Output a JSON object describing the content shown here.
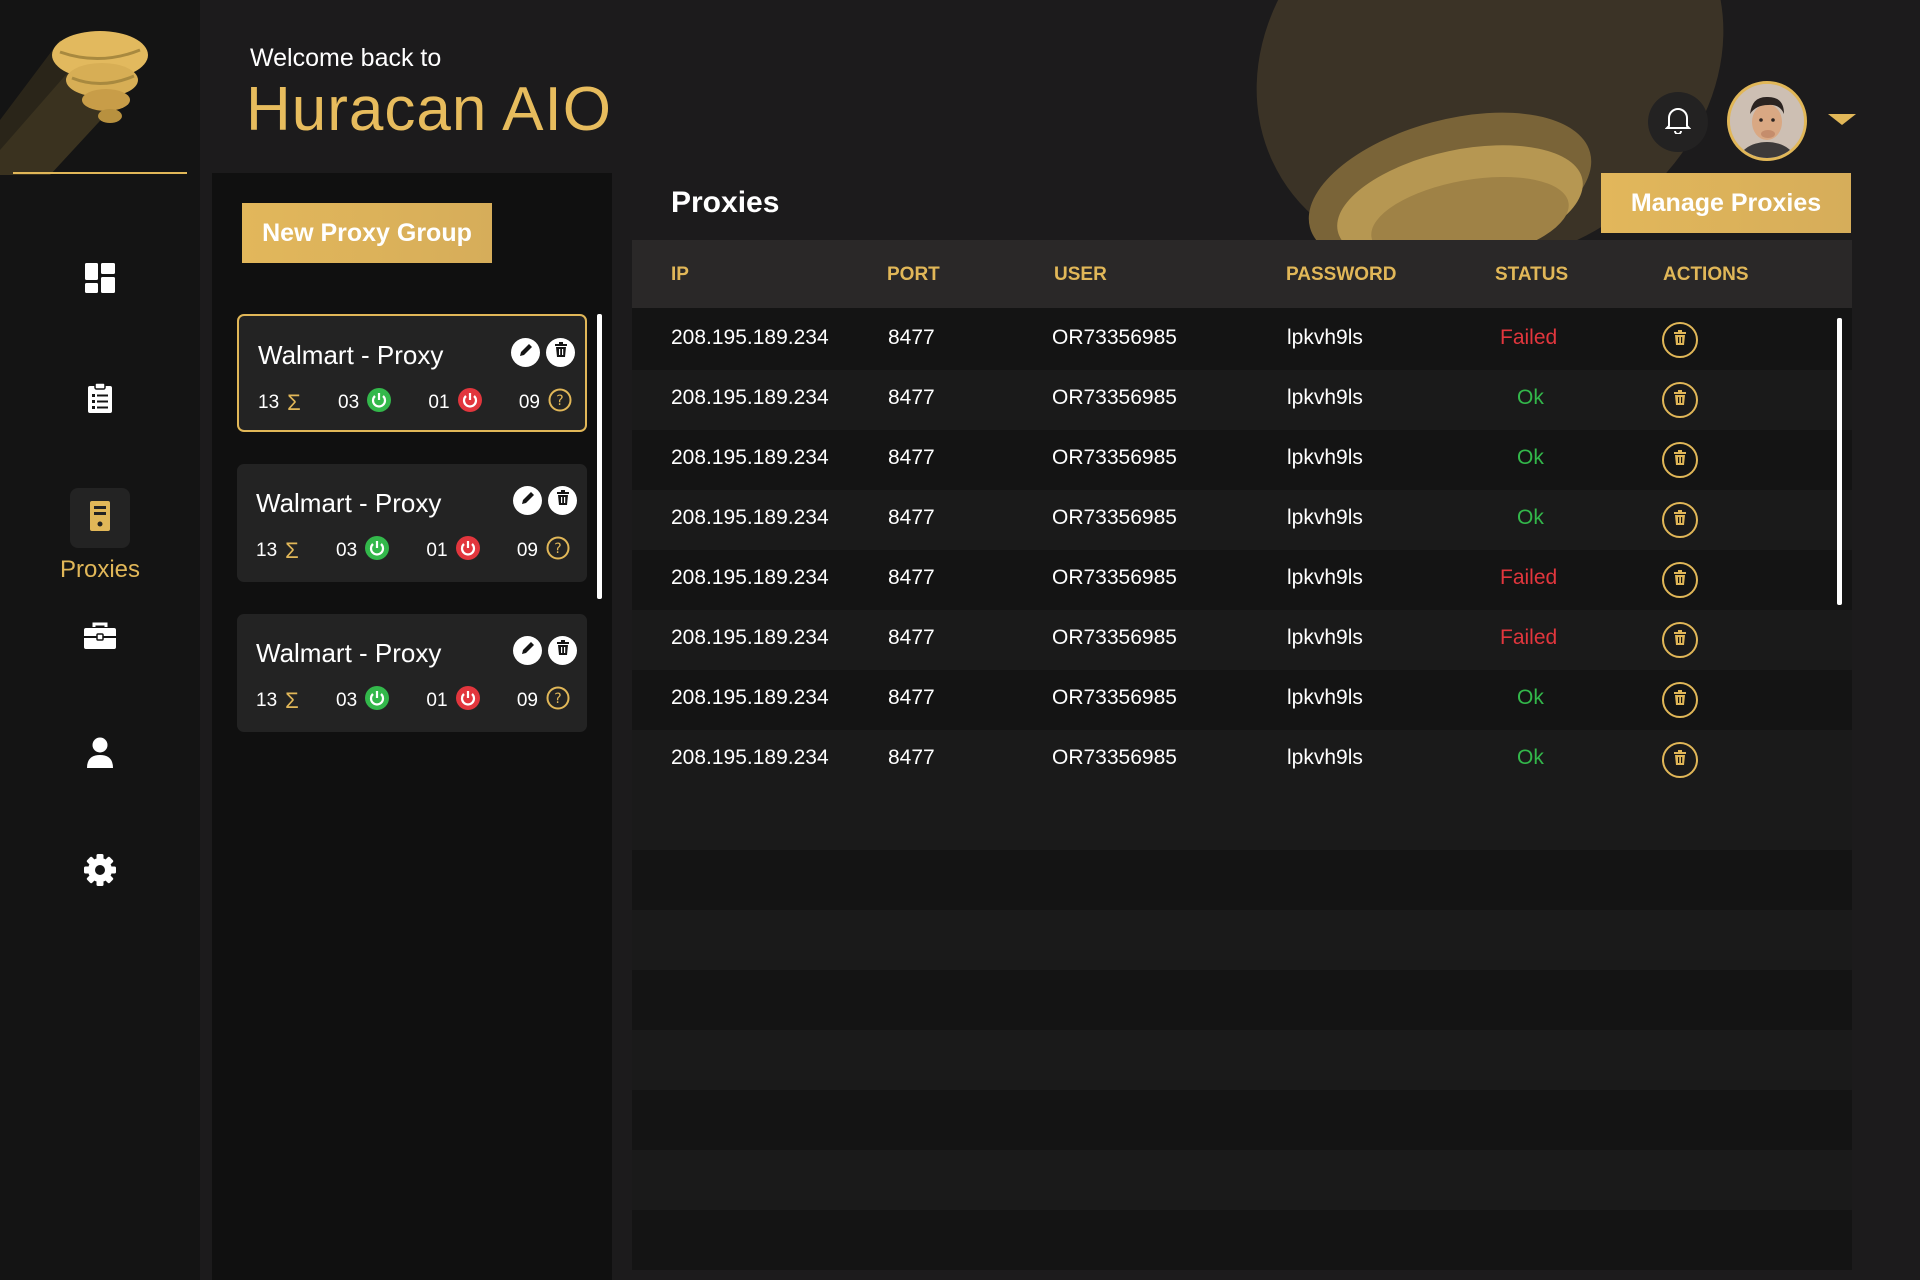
{
  "app": {
    "welcome": "Welcome back to",
    "brand": "Huracan AIO"
  },
  "sidebar": {
    "items": [
      {
        "name": "dashboard",
        "icon": "dashboard-icon",
        "label": ""
      },
      {
        "name": "tasks",
        "icon": "clipboard-icon",
        "label": ""
      },
      {
        "name": "proxies",
        "icon": "proxy-icon",
        "label": "Proxies",
        "active": true
      },
      {
        "name": "profiles",
        "icon": "briefcase-icon",
        "label": ""
      },
      {
        "name": "accounts",
        "icon": "user-icon",
        "label": ""
      },
      {
        "name": "settings",
        "icon": "gear-icon",
        "label": ""
      }
    ]
  },
  "groups": {
    "new_button": "New Proxy Group",
    "cards": [
      {
        "title": "Walmart - Proxy",
        "total": "13",
        "ok": "03",
        "failed": "01",
        "unknown": "09",
        "selected": true
      },
      {
        "title": "Walmart - Proxy",
        "total": "13",
        "ok": "03",
        "failed": "01",
        "unknown": "09",
        "selected": false
      },
      {
        "title": "Walmart - Proxy",
        "total": "13",
        "ok": "03",
        "failed": "01",
        "unknown": "09",
        "selected": false
      }
    ]
  },
  "proxies": {
    "title": "Proxies",
    "manage_button": "Manage Proxies",
    "columns": [
      "IP",
      "PORT",
      "USER",
      "PASSWORD",
      "STATUS",
      "ACTIONS"
    ],
    "rows": [
      {
        "ip": "208.195.189.234",
        "port": "8477",
        "user": "OR73356985",
        "password": "lpkvh9ls",
        "status": "Failed"
      },
      {
        "ip": "208.195.189.234",
        "port": "8477",
        "user": "OR73356985",
        "password": "lpkvh9ls",
        "status": "Ok"
      },
      {
        "ip": "208.195.189.234",
        "port": "8477",
        "user": "OR73356985",
        "password": "lpkvh9ls",
        "status": "Ok"
      },
      {
        "ip": "208.195.189.234",
        "port": "8477",
        "user": "OR73356985",
        "password": "lpkvh9ls",
        "status": "Ok"
      },
      {
        "ip": "208.195.189.234",
        "port": "8477",
        "user": "OR73356985",
        "password": "lpkvh9ls",
        "status": "Failed"
      },
      {
        "ip": "208.195.189.234",
        "port": "8477",
        "user": "OR73356985",
        "password": "lpkvh9ls",
        "status": "Failed"
      },
      {
        "ip": "208.195.189.234",
        "port": "8477",
        "user": "OR73356985",
        "password": "lpkvh9ls",
        "status": "Ok"
      },
      {
        "ip": "208.195.189.234",
        "port": "8477",
        "user": "OR73356985",
        "password": "lpkvh9ls",
        "status": "Ok"
      }
    ]
  },
  "colors": {
    "accent": "#e1b758",
    "ok": "#33b84b",
    "failed": "#e2363d",
    "background": "#1c1b1c"
  }
}
